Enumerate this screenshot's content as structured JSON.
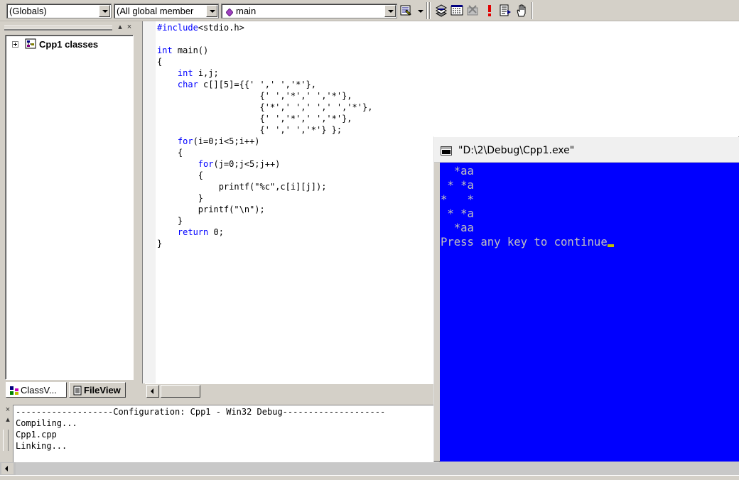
{
  "toolbar": {
    "scope_combo": "(Globals)",
    "members_combo": "(All global member",
    "function_combo": "main",
    "icons": [
      "wizard-bar-actions-icon",
      "compile-icon",
      "build-icon",
      "stop-build-icon",
      "execute-icon",
      "go-icon",
      "breakpoint-icon"
    ]
  },
  "classview": {
    "tree_root": "Cpp1 classes",
    "tabs": [
      {
        "label": "ClassV...",
        "icon": "classview-icon"
      },
      {
        "label": "FileView",
        "icon": "fileview-icon"
      }
    ]
  },
  "editor": {
    "lines": [
      "#include<stdio.h>",
      "",
      "int main()",
      "{",
      "    int i,j;",
      "    char c[][5]={{' ',' ','*'},",
      "                    {' ','*',' ','*'},",
      "                    {'*',' ',' ',' ','*'},",
      "                    {' ','*',' ','*'},",
      "                    {' ',' ','*'} };",
      "    for(i=0;i<5;i++)",
      "    {",
      "        for(j=0;j<5;j++)",
      "        {",
      "            printf(\"%c\",c[i][j]);",
      "        }",
      "        printf(\"\\n\");",
      "    }",
      "    return 0;",
      "}"
    ]
  },
  "output": {
    "lines": [
      "-------------------Configuration: Cpp1 - Win32 Debug--------------------",
      "Compiling...",
      "Cpp1.cpp",
      "Linking..."
    ]
  },
  "console": {
    "title": "\"D:\\2\\Debug\\Cpp1.exe\"",
    "lines": [
      "  *aa",
      " * *a",
      "*   *",
      " * *a",
      "  *aa",
      "Press any key to continue"
    ],
    "background": "#0000ff",
    "text_color": "#c0c0c0"
  }
}
